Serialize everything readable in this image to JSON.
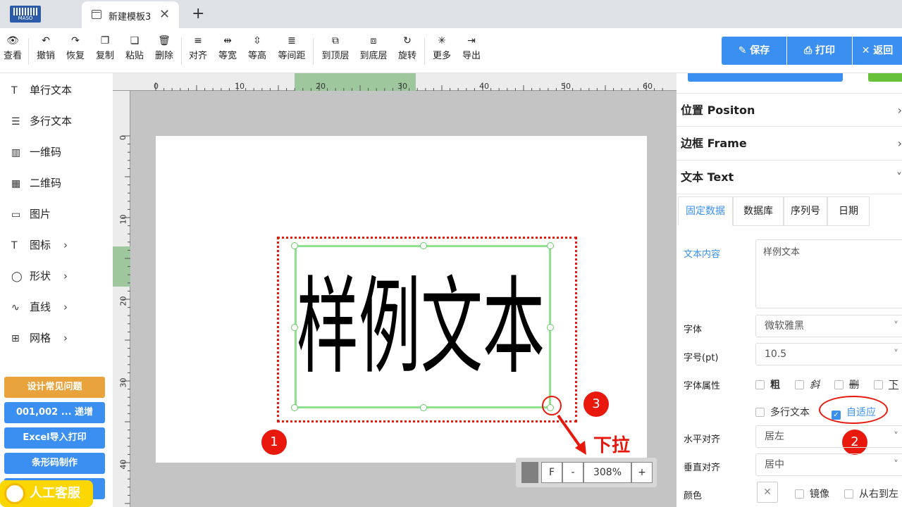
{
  "tab": {
    "title": "新建模板3",
    "close": "✕",
    "new": "+"
  },
  "logo": {
    "text": "MASO"
  },
  "toolbar": {
    "items": [
      "查看",
      "撤销",
      "恢复",
      "复制",
      "粘贴",
      "删除",
      "对齐",
      "等宽",
      "等高",
      "等间距",
      "到顶层",
      "到底层",
      "旋转",
      "更多",
      "导出"
    ],
    "icons": [
      "👁",
      "↶",
      "↷",
      "❐",
      "❏",
      "🗑",
      "≡",
      "⇹",
      "⇳",
      "≣",
      "⧉",
      "⧈",
      "↻",
      "✳",
      "⇥"
    ],
    "save": "保存",
    "print": "打印",
    "back": "返回"
  },
  "sidebar": {
    "items": [
      {
        "label": "单行文本",
        "icon": "T"
      },
      {
        "label": "多行文本",
        "icon": "☰"
      },
      {
        "label": "一维码",
        "icon": "▥"
      },
      {
        "label": "二维码",
        "icon": "▦"
      },
      {
        "label": "图片",
        "icon": "▭"
      },
      {
        "label": "图标",
        "icon": "T"
      },
      {
        "label": "形状",
        "icon": "◯"
      },
      {
        "label": "直线",
        "icon": "∿"
      },
      {
        "label": "网格",
        "icon": "⊞"
      }
    ],
    "buttons": [
      "设计常见问题",
      "001,002 ... 递增",
      "Excel导入打印",
      "条形码制作"
    ],
    "customer_service": "人工客服"
  },
  "ruler": {
    "h": [
      "0",
      "10",
      "20",
      "30",
      "40",
      "50",
      "60"
    ],
    "v": [
      "0",
      "10",
      "20",
      "30",
      "40"
    ]
  },
  "canvas": {
    "sample_text": "样例文本",
    "zoom": "308%",
    "zoom_f": "F",
    "zoom_minus": "-",
    "zoom_plus": "+"
  },
  "annotations": {
    "n1": "1",
    "n2": "2",
    "n3": "3",
    "pull": "下拉"
  },
  "right": {
    "sections": [
      "位置 Positon",
      "边框 Frame",
      "文本 Text"
    ],
    "subtabs": [
      "固定数据",
      "数据库",
      "序列号",
      "日期"
    ],
    "text_content_label": "文本内容",
    "text_content": "样例文本",
    "font_label": "字体",
    "font": "微软雅黑",
    "size_label": "字号(pt)",
    "size": "10.5",
    "attr_label": "字体属性",
    "attrs": [
      "粗",
      "斜",
      "删",
      "下"
    ],
    "multiline": "多行文本",
    "autofit": "自适应",
    "halign_label": "水平对齐",
    "halign": "居左",
    "valign_label": "垂直对齐",
    "valign": "居中",
    "color_label": "颜色",
    "mirror": "镜像",
    "rtl": "从右到左"
  },
  "colors": {
    "accent": "#3b8ff0",
    "red": "#e8180c",
    "green": "#8fd68f"
  }
}
